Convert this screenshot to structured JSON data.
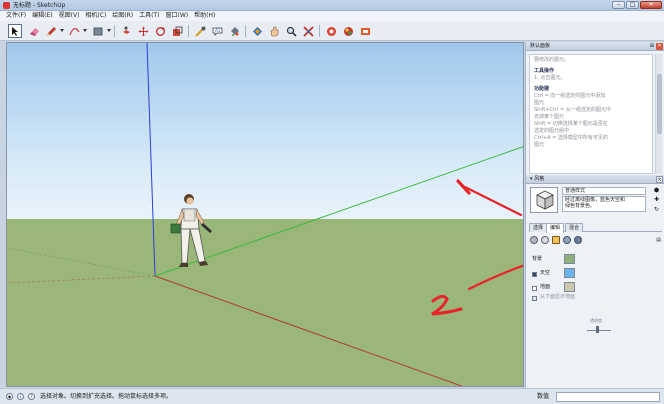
{
  "window": {
    "title": "无标题 - SketchUp",
    "minimize": "–",
    "maximize": "□",
    "close": "✕"
  },
  "menu": [
    "文件(F)",
    "编辑(E)",
    "视图(V)",
    "相机(C)",
    "绘图(R)",
    "工具(T)",
    "窗口(W)",
    "帮助(H)"
  ],
  "toolbar": {
    "tools": [
      "select-arrow-icon",
      "eraser-icon",
      "pencil-icon",
      "arc-icon",
      "rectangle-icon",
      "push-pull-icon",
      "move-icon",
      "rotate-icon",
      "scale-icon",
      "offset-icon",
      "tape-measure-icon",
      "text-icon",
      "paint-bucket-icon",
      "orbit-icon",
      "pan-icon",
      "zoom-icon",
      "zoom-extents-icon",
      "warehouse-icon",
      "extension-warehouse-icon",
      "send-to-layout-icon"
    ]
  },
  "instructor": {
    "tail": "要修改的图元。",
    "ops_title": "工具操作",
    "ops_1": "1. 点击图元。",
    "keys_title": "功能键",
    "keys": [
      "Ctrl = 向一组选定的图元中添加",
      "图元",
      "Shift+Ctrl = 从一组选定的图元中",
      "去掉某个图元",
      "Shift = 切换选择某个图元是否在",
      "选定的图元组中",
      "Ctrl+A = 选择模型中所有可见的",
      "图元"
    ]
  },
  "panel": {
    "tray_title": "默认面板",
    "styles_title": "▾ 风格",
    "style_name": "普通样式",
    "style_desc_1": "经过离线图像，蓝色天空和",
    "style_desc_2": "绿色背景色。",
    "tabs": [
      "选择",
      "编辑",
      "混合"
    ],
    "background_label": "背景",
    "sky_label": "天空",
    "ground_label": "地面",
    "transparency_label": "透明度",
    "underground_label": "从下面显示地面"
  },
  "colors": {
    "background_swatch": "#8fb07a",
    "sky_swatch": "#6cb3e6",
    "ground_swatch": "#cdc8ad",
    "annotation_red": "#e8242b"
  },
  "annotations": [
    "1",
    "2"
  ],
  "status": {
    "text": "选择对象。切换到扩充选择。拖动鼠标选择多项。",
    "measure_label": "数值",
    "measure_value": ""
  }
}
